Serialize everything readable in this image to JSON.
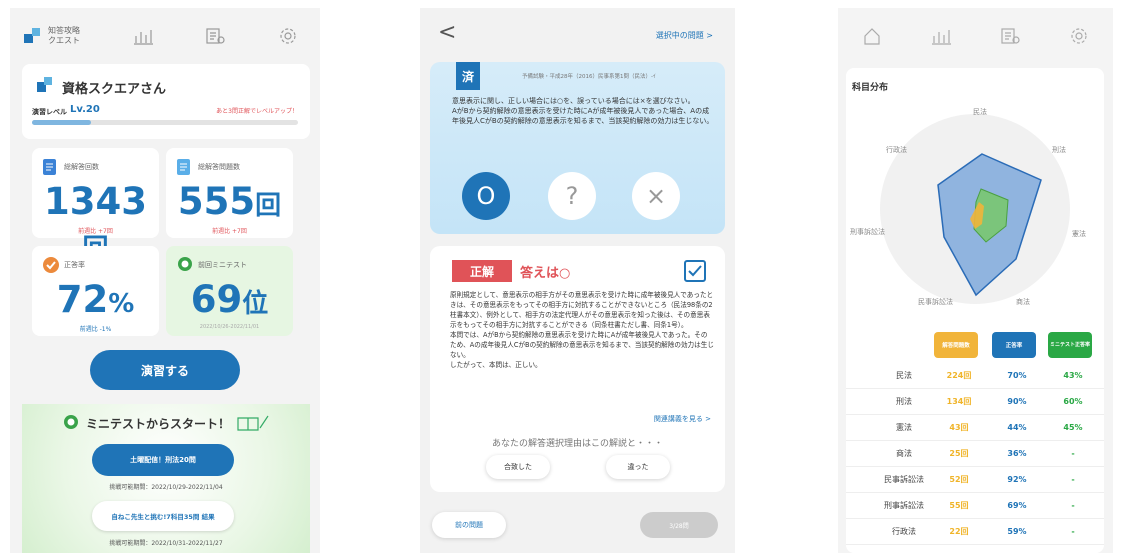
{
  "screen1": {
    "logo_line1": "知答攻略",
    "logo_line2": "クエスト",
    "username": "資格スクエアさん",
    "level_label": "演習レベル",
    "level_value": "Lv.20",
    "level_hint": "あと3問正解でレベルアップ！",
    "level_progress": 0.22,
    "total_answers": {
      "label": "総解答回数",
      "value": "1343",
      "unit": "回",
      "sub": "前週比 +7回"
    },
    "total_questions": {
      "label": "総解答問題数",
      "value": "555",
      "unit": "回",
      "sub": "前週比 +7回"
    },
    "accuracy": {
      "label": "正答率",
      "value": "72",
      "unit": "%",
      "sub": "前週比 -1%"
    },
    "mini_test": {
      "label": "前回ミニテスト",
      "value": "69",
      "unit": "位",
      "sub": "2022/10/26-2022/11/01"
    },
    "practice_button": "演習する",
    "mini_start_title": "ミニテストからスタート！",
    "mini1_button": "土曜配信！刑法20問",
    "mini1_period": "挑戦可能期間：2022/10/29-2022/11/04",
    "mini2_button": "自ねこ先生と挑む!7科目35問 結果",
    "mini2_period": "挑戦可能期間：2022/10/31-2022/11/27"
  },
  "screen2": {
    "back": "<",
    "selected_link": "選択中の問題 >",
    "done_badge": "済",
    "question_source": "予備試験・平成28年（2016）民事系第1問（民法）-ｲ",
    "question_text": "意思表示に関し、正しい場合には○を、誤っている場合には×を選びなさい。\nAがBから契約解除の意思表示を受けた時にAが成年被後見人であった場合、Aの成年後見人CがBの契約解除の意思表示を知るまで、当該契約解除の効力は生じない。",
    "opt_o": "O",
    "opt_q": "?",
    "opt_x": "×",
    "correct_badge": "正解",
    "answer_title": "答えは○",
    "explanation": "原則規定として、意思表示の相手方がその意思表示を受けた時に成年被後見人であったときは、その意思表示をもってその相手方に対抗することができないところ（民法98条の2柱書本文）、例外として、相手方の法定代理人がその意思表示を知った後は、その意思表示をもってその相手方に対抗することができる（同条柱書ただし書、同条1号）。\n本問では、AがBから契約解除の意思表示を受けた時にAが成年被後見人であった。そのため、Aの成年後見人CがBの契約解除の意思表示を知るまで、当該契約解除の効力は生じない。\nしたがって、本問は、正しい。",
    "related_link": "関連講義を見る >",
    "reason_prompt": "あなたの解答選択理由はこの解説と・・・",
    "agree_button": "合致した",
    "differ_button": "違った",
    "prev_button": "前の問題",
    "page_indicator": "3/28問"
  },
  "screen3": {
    "section_title": "科目分布",
    "radar_axes": [
      "民法",
      "刑法",
      "憲法",
      "商法",
      "民事訴訟法",
      "刑事訴訟法",
      "行政法"
    ],
    "legend": {
      "col1": "解答問題数",
      "col2": "正答率",
      "col3": "ミニテスト正答率"
    },
    "rows": [
      {
        "subject": "民法",
        "count": "224回",
        "rate": "70%",
        "mini": "43%"
      },
      {
        "subject": "刑法",
        "count": "134回",
        "rate": "90%",
        "mini": "60%"
      },
      {
        "subject": "憲法",
        "count": "43回",
        "rate": "44%",
        "mini": "45%"
      },
      {
        "subject": "商法",
        "count": "25回",
        "rate": "36%",
        "mini": "-"
      },
      {
        "subject": "民事訴訟法",
        "count": "52回",
        "rate": "92%",
        "mini": "-"
      },
      {
        "subject": "刑事訴訟法",
        "count": "55回",
        "rate": "69%",
        "mini": "-"
      },
      {
        "subject": "行政法",
        "count": "22回",
        "rate": "59%",
        "mini": "-"
      }
    ]
  }
}
